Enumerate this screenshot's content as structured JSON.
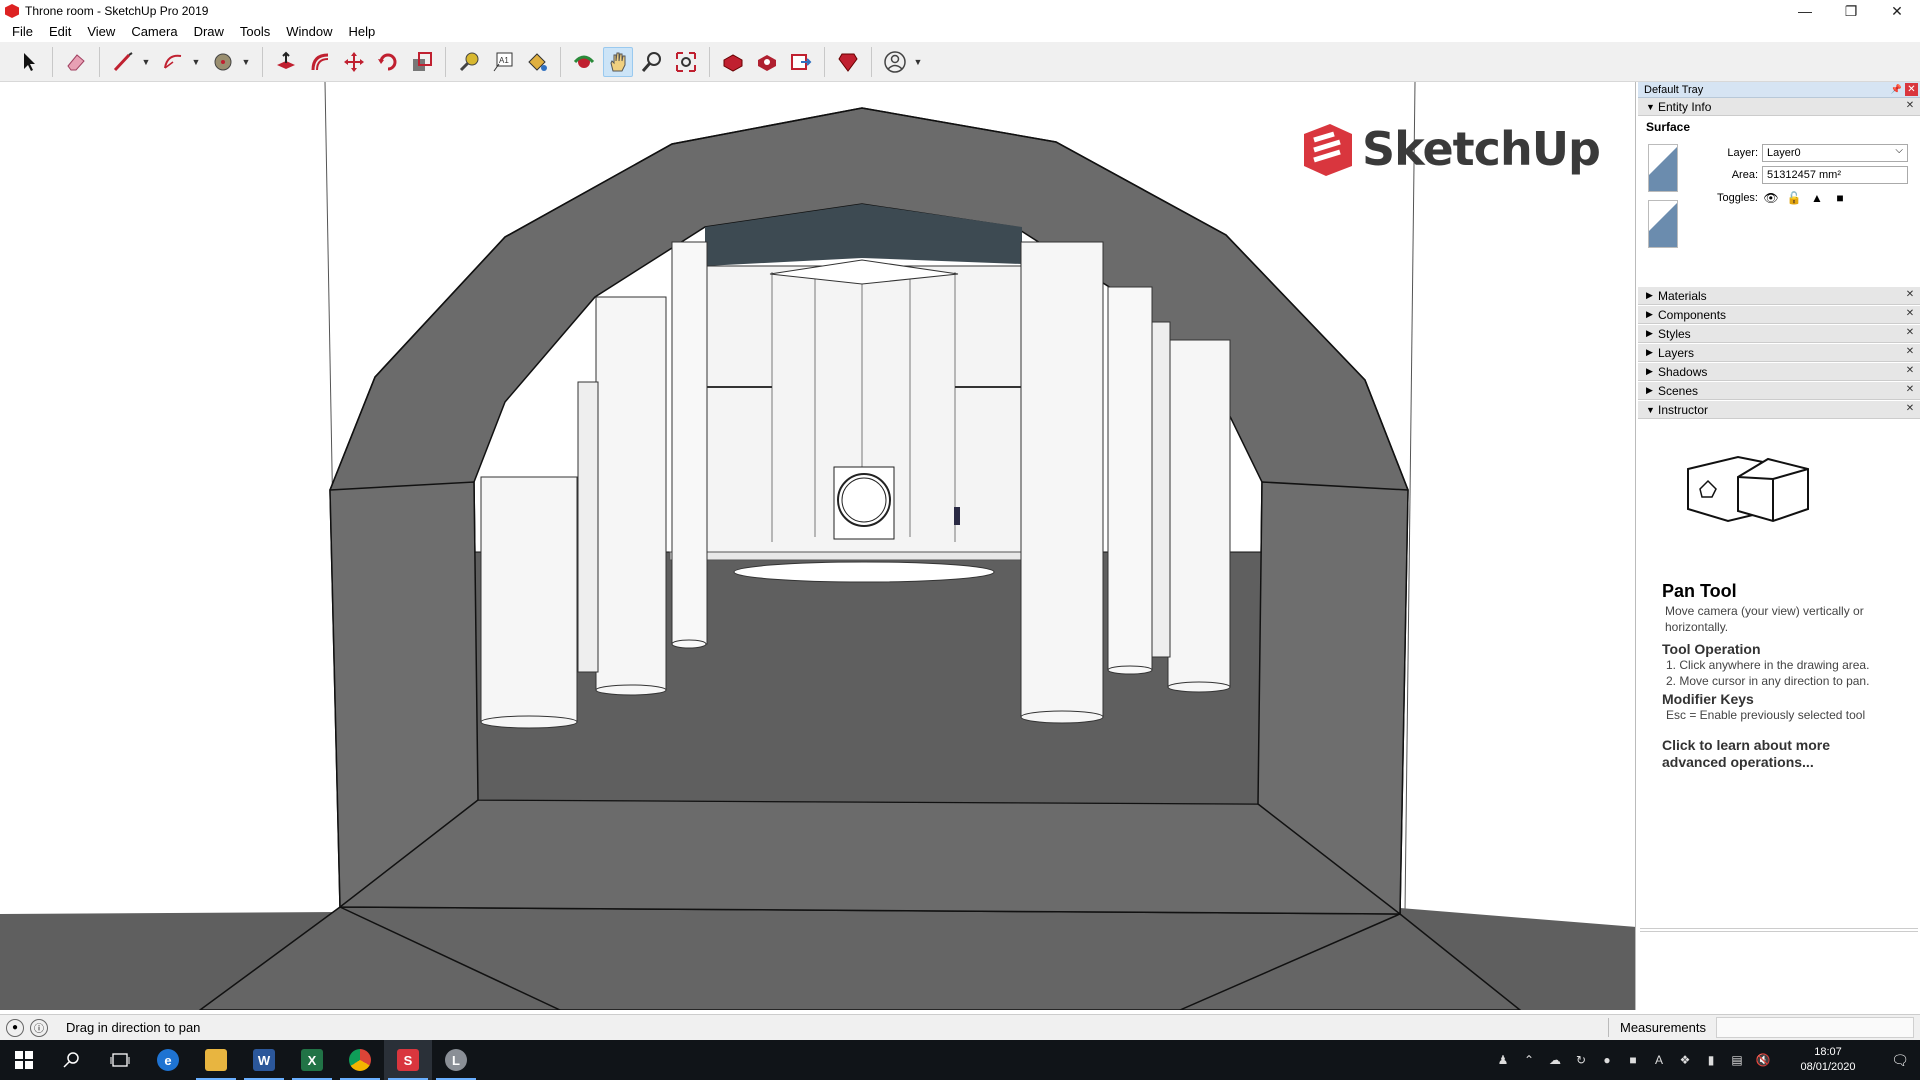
{
  "window": {
    "title": "Throne room - SketchUp Pro 2019",
    "controls": [
      "minimize-icon",
      "restore-icon",
      "close-icon"
    ]
  },
  "menu": [
    "File",
    "Edit",
    "View",
    "Camera",
    "Draw",
    "Tools",
    "Window",
    "Help"
  ],
  "toolbar": {
    "tools": [
      "select",
      "eraser",
      "line",
      "arc",
      "shapes",
      "push-pull",
      "offset",
      "move",
      "rotate",
      "scale",
      "tape-measure",
      "text",
      "paint-bucket",
      "orbit",
      "pan",
      "zoom",
      "zoom-extents",
      "3d-warehouse",
      "extension-warehouse",
      "layout",
      "extension-manager",
      "account"
    ],
    "active_tool": "pan"
  },
  "viewport": {
    "logo_text": "SketchUp",
    "brand_color": "#d9363e",
    "wall_color": "#6b6b6b",
    "floor_color": "#5f5f5f"
  },
  "tray": {
    "title": "Default Tray",
    "entity_info": {
      "header": "Entity Info",
      "type": "Surface",
      "layer_label": "Layer:",
      "layer_value": "Layer0",
      "area_label": "Area:",
      "area_value": "51312457 mm²",
      "toggles_label": "Toggles:"
    },
    "panels": [
      "Materials",
      "Components",
      "Styles",
      "Layers",
      "Shadows",
      "Scenes"
    ],
    "instructor": {
      "header": "Instructor",
      "tool_name": "Pan Tool",
      "description": "Move camera (your view) vertically or horizontally.",
      "operation_title": "Tool Operation",
      "operation_steps": [
        "1. Click anywhere in the drawing area.",
        "2. Move cursor in any direction to pan."
      ],
      "modifier_title": "Modifier Keys",
      "modifier_text": "Esc = Enable previously selected tool",
      "learn_more": "Click to learn about more advanced operations..."
    }
  },
  "statusbar": {
    "hint": "Drag in direction to pan",
    "measurements_label": "Measurements",
    "measurements_value": ""
  },
  "taskbar": {
    "apps": [
      "start",
      "search",
      "task-view",
      "edge",
      "file-explorer",
      "word",
      "excel",
      "chrome",
      "sketchup",
      "layout"
    ],
    "clock_time": "18:07",
    "clock_date": "08/01/2020"
  }
}
